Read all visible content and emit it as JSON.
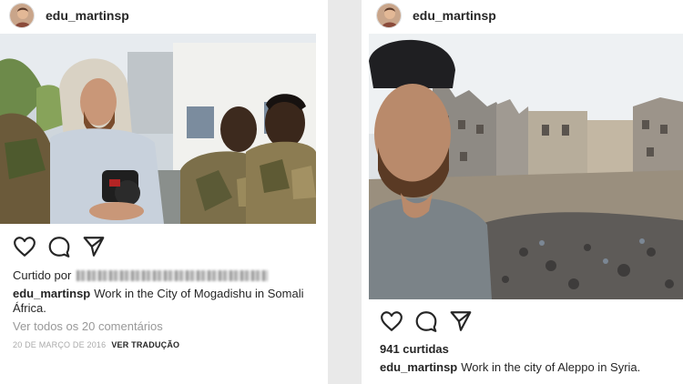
{
  "posts": [
    {
      "username": "edu_martinsp",
      "liked_by_prefix": "Curtido por",
      "caption_user": "edu_martinsp",
      "caption_line1": "Work in the City of Mogadishu in Somali",
      "caption_line2": "África.",
      "comments_link": "Ver todos os 20 comentários",
      "date": "20 DE MARÇO DE 2016",
      "translate": "VER TRADUÇÃO",
      "icons": [
        "heart-icon",
        "comment-icon",
        "share-icon"
      ]
    },
    {
      "username": "edu_martinsp",
      "likes": "941 curtidas",
      "caption_user": "edu_martinsp",
      "caption_text": "Work in the city of Aleppo in Syria.",
      "icons": [
        "heart-icon",
        "comment-icon",
        "share-icon"
      ]
    }
  ]
}
